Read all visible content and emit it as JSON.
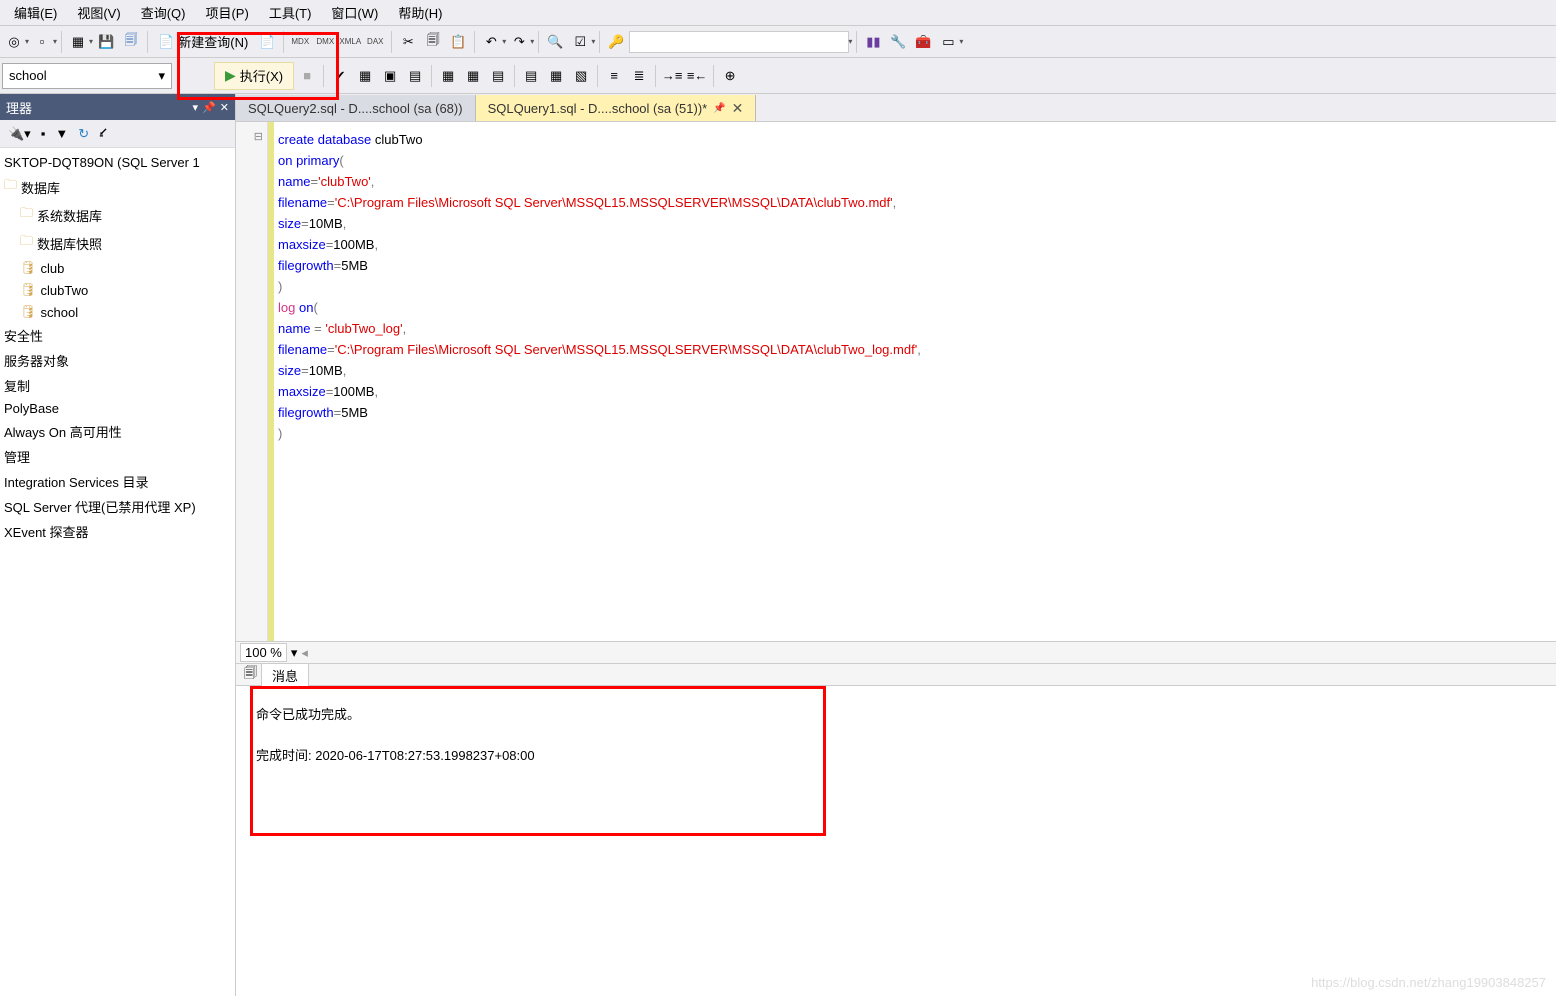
{
  "menu": {
    "edit": "编辑(E)",
    "view": "视图(V)",
    "query": "查询(Q)",
    "project": "项目(P)",
    "tools": "工具(T)",
    "window": "窗口(W)",
    "help": "帮助(H)"
  },
  "toolbar1": {
    "newQuery": "新建查询(N)",
    "iconLabels": [
      "MDX",
      "DMX",
      "XMLA",
      "DAX"
    ]
  },
  "toolbar2": {
    "selectedDb": "school",
    "execute": "执行(X)"
  },
  "sidebar": {
    "title": "理器",
    "server": "SKTOP-DQT89ON (SQL Server 1",
    "items": [
      {
        "label": "数据库",
        "icon": "folder",
        "indent": 0
      },
      {
        "label": "系统数据库",
        "icon": "folder",
        "indent": 1
      },
      {
        "label": "数据库快照",
        "icon": "folder",
        "indent": 1
      },
      {
        "label": "club",
        "icon": "db",
        "indent": 1
      },
      {
        "label": "clubTwo",
        "icon": "db",
        "indent": 1
      },
      {
        "label": "school",
        "icon": "db",
        "indent": 1
      },
      {
        "label": "安全性",
        "icon": "none",
        "indent": 0
      },
      {
        "label": "服务器对象",
        "icon": "none",
        "indent": 0
      },
      {
        "label": "复制",
        "icon": "none",
        "indent": 0
      },
      {
        "label": "PolyBase",
        "icon": "none",
        "indent": 0
      },
      {
        "label": "Always On 高可用性",
        "icon": "none",
        "indent": 0
      },
      {
        "label": "管理",
        "icon": "none",
        "indent": 0
      },
      {
        "label": "Integration Services 目录",
        "icon": "none",
        "indent": 0
      },
      {
        "label": "SQL Server 代理(已禁用代理 XP)",
        "icon": "none",
        "indent": 0
      },
      {
        "label": "XEvent 探查器",
        "icon": "none",
        "indent": 0
      }
    ]
  },
  "tabs": {
    "inactive": "SQLQuery2.sql - D....school (sa (68))",
    "active": "SQLQuery1.sql - D....school (sa (51))*"
  },
  "code": {
    "l1a": "create",
    "l1b": " database",
    "l1c": " clubTwo",
    "l2a": "on",
    "l2b": " primary",
    "l2c": "(",
    "l3a": "name",
    "l3b": "=",
    "l3c": "'clubTwo'",
    "l3d": ",",
    "l4a": "filename",
    "l4b": "=",
    "l4c": "'C:\\Program Files\\Microsoft SQL Server\\MSSQL15.MSSQLSERVER\\MSSQL\\DATA\\clubTwo.mdf'",
    "l4d": ",",
    "l5a": "size",
    "l5b": "=",
    "l5c": "10MB",
    "l5d": ",",
    "l6a": "maxsize",
    "l6b": "=",
    "l6c": "100MB",
    "l6d": ",",
    "l7a": "filegrowth",
    "l7b": "=",
    "l7c": "5MB",
    "l8": ")",
    "l9a": "log",
    "l9b": " on",
    "l9c": "(",
    "l10a": "name",
    "l10b": " =",
    "l10c": " 'clubTwo_log'",
    "l10d": ",",
    "l11a": "filename",
    "l11b": "=",
    "l11c": "'C:\\Program Files\\Microsoft SQL Server\\MSSQL15.MSSQLSERVER\\MSSQL\\DATA\\clubTwo_log.mdf'",
    "l11d": ",",
    "l12a": "size",
    "l12b": "=",
    "l12c": "10MB",
    "l12d": ",",
    "l13a": "maxsize",
    "l13b": "=",
    "l13c": "100MB",
    "l13d": ",",
    "l14a": "filegrowth",
    "l14b": "=",
    "l14c": "5MB",
    "l15": ")"
  },
  "zoom": "100 %",
  "msgTab": "消息",
  "messages": {
    "line1": "命令已成功完成。",
    "line2": "完成时间: 2020-06-17T08:27:53.1998237+08:00"
  },
  "watermark": "https://blog.csdn.net/zhang19903848257"
}
